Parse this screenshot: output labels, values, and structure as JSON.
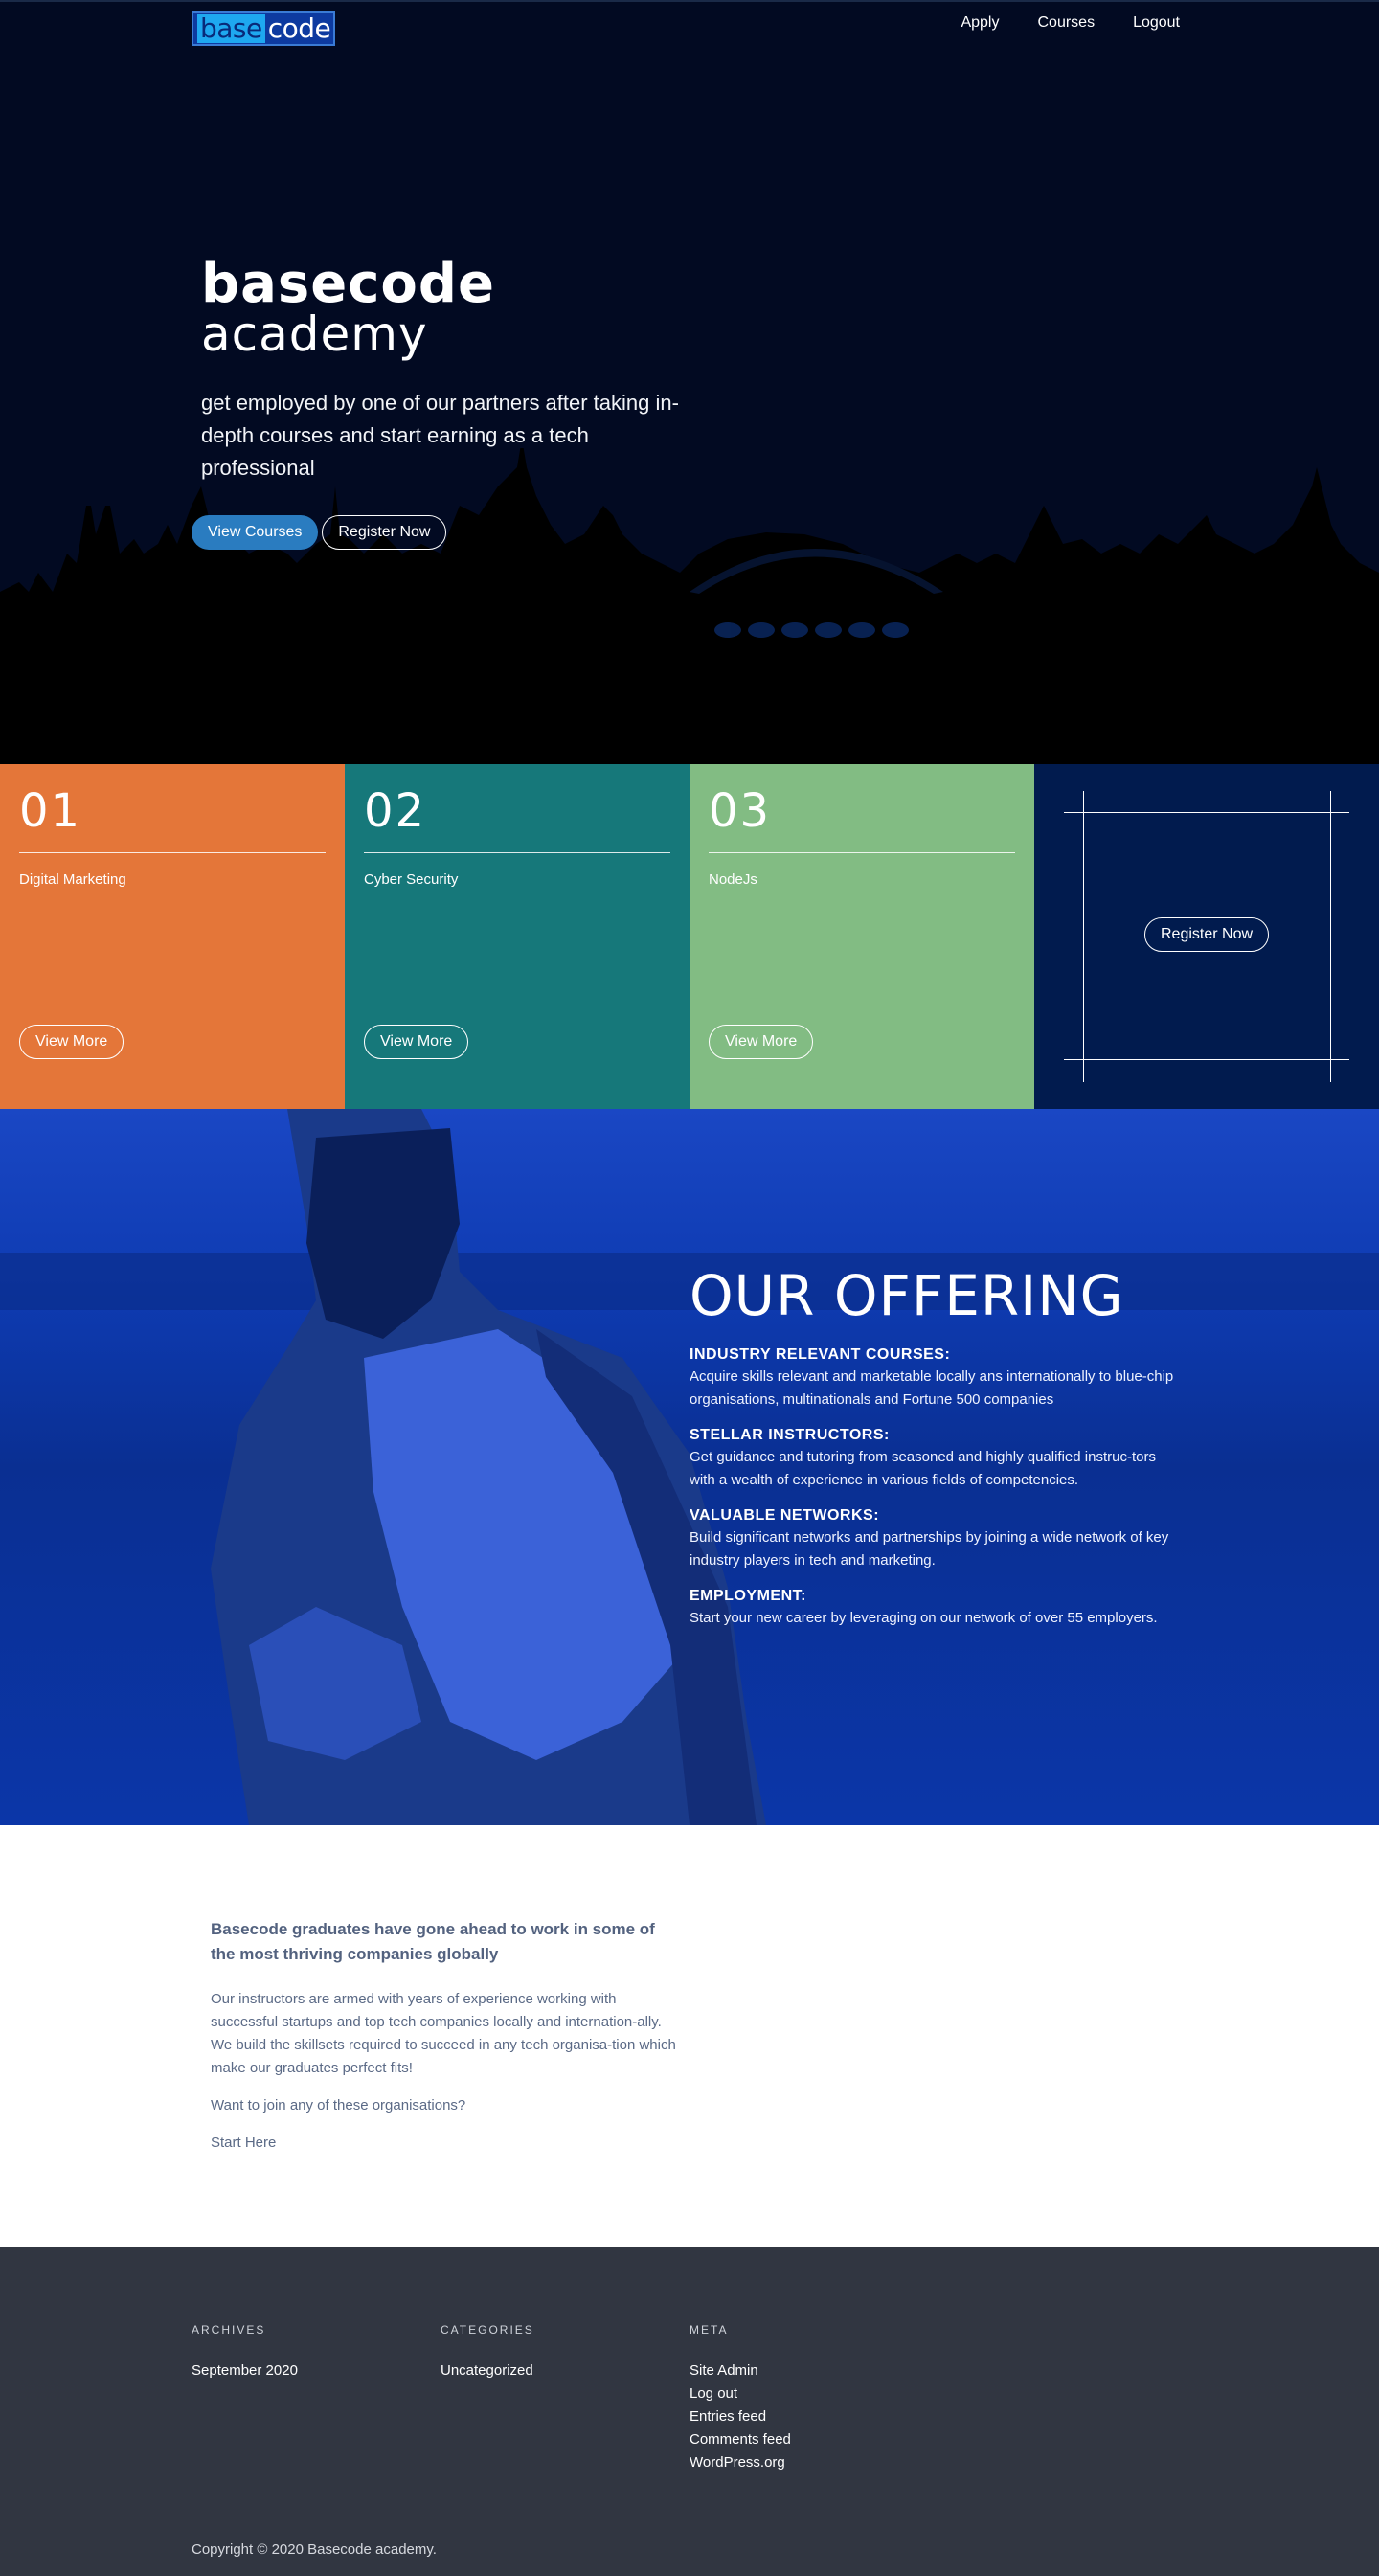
{
  "header": {
    "logo_base": "base",
    "logo_code": "code",
    "nav": [
      "Apply",
      "Courses",
      "Logout"
    ]
  },
  "hero": {
    "brand_line1": "basecode",
    "brand_line2": "academy",
    "tagline": "get employed by one of our partners after taking in-depth courses and start earning as a tech professional",
    "view_courses": "View Courses",
    "register": "Register Now"
  },
  "courses": [
    {
      "num": "01",
      "title": "Digital Marketing",
      "button": "View More",
      "color": "#e47639"
    },
    {
      "num": "02",
      "title": "Cyber Security",
      "button": "View More",
      "color": "#16787a"
    },
    {
      "num": "03",
      "title": "NodeJs",
      "button": "View More",
      "color": "#82bc83"
    }
  ],
  "register_card": {
    "button": "Register Now",
    "color": "#011b4e"
  },
  "offering": {
    "title": "OUR OFFERING",
    "items": [
      {
        "heading": "INDUSTRY RELEVANT COURSES:",
        "text": "Acquire skills relevant and marketable locally ans internationally to blue-chip organisations, multinationals and Fortune 500 companies"
      },
      {
        "heading": "STELLAR INSTRUCTORS:",
        "text": "Get guidance and tutoring from seasoned and highly qualified instruc-tors with a wealth of experience in various fields of competencies."
      },
      {
        "heading": "VALUABLE NETWORKS:",
        "text": "Build significant networks and partnerships by joining a wide network of key industry players in tech and marketing."
      },
      {
        "heading": "EMPLOYMENT:",
        "text": "Start your new career by leveraging on our network of over 55 employers."
      }
    ]
  },
  "graduates": {
    "heading": "Basecode graduates have gone ahead to work in some of the most thriving companies globally",
    "paragraph": "Our instructors are armed with years of experience working with successful startups and top tech companies locally and internation-ally. We build the skillsets required to succeed in any tech organisa-tion which make our graduates perfect fits!",
    "question": "Want to join any of these organisations?",
    "link": "Start Here"
  },
  "footer": {
    "archives": {
      "heading": "ARCHIVES",
      "links": [
        "September 2020"
      ]
    },
    "categories": {
      "heading": "CATEGORIES",
      "links": [
        "Uncategorized"
      ]
    },
    "meta": {
      "heading": "META",
      "links": [
        "Site Admin",
        "Log out",
        "Entries feed",
        "Comments feed",
        "WordPress.org"
      ]
    },
    "copyright": "Copyright © 2020 Basecode academy."
  },
  "colors": {
    "hero_bg": "#020a22",
    "accent_button": "#2a7cc0",
    "offering_bg": "#0b36a8",
    "footer_bg": "#313641"
  }
}
